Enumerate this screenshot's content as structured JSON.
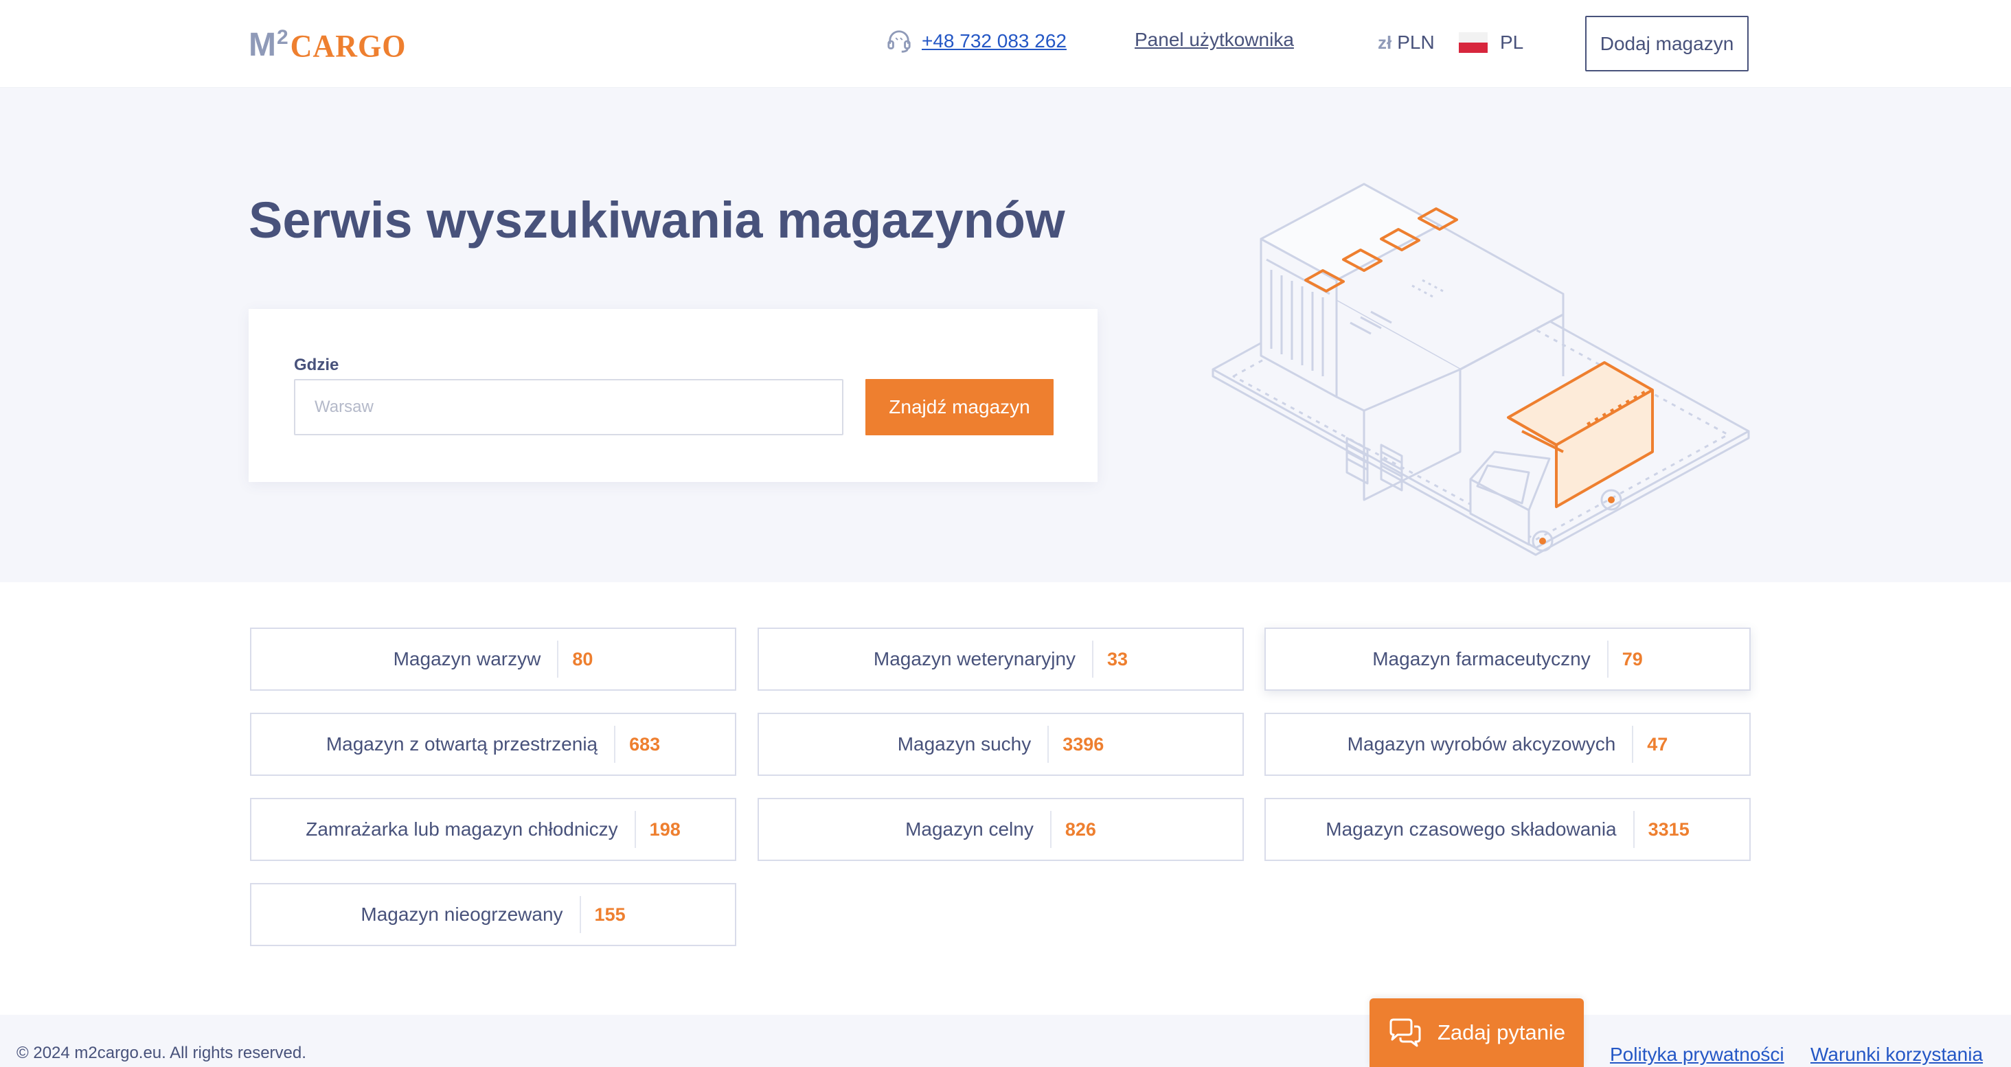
{
  "header": {
    "logo": {
      "m": "M",
      "sup": "2",
      "cargo": "CARGO"
    },
    "phone": "+48 732 083 262",
    "panel_link": "Panel użytkownika",
    "currency": {
      "symbol": "zł",
      "code": "PLN"
    },
    "language": "PL",
    "add_button": "Dodaj magazyn"
  },
  "hero": {
    "title": "Serwis wyszukiwania magazynów",
    "search": {
      "label": "Gdzie",
      "placeholder": "Warsaw",
      "button": "Znajdź magazyn"
    }
  },
  "categories": [
    {
      "name": "Magazyn warzyw",
      "count": "80"
    },
    {
      "name": "Magazyn weterynaryjny",
      "count": "33"
    },
    {
      "name": "Magazyn farmaceutyczny",
      "count": "79"
    },
    {
      "name": "Magazyn z otwartą przestrzenią",
      "count": "683"
    },
    {
      "name": "Magazyn suchy",
      "count": "3396"
    },
    {
      "name": "Magazyn wyrobów akcyzowych",
      "count": "47"
    },
    {
      "name": "Zamrażarka lub magazyn chłodniczy",
      "count": "198"
    },
    {
      "name": "Magazyn celny",
      "count": "826"
    },
    {
      "name": "Magazyn czasowego składowania",
      "count": "3315"
    },
    {
      "name": "Magazyn nieogrzewany",
      "count": "155"
    }
  ],
  "footer": {
    "copyright": "© 2024 m2cargo.eu. All rights reserved.",
    "ask_button": "Zadaj pytanie",
    "privacy": "Polityka prywatności",
    "terms": "Warunki korzystania"
  },
  "colors": {
    "accent": "#ee7f2f",
    "text": "#48527b",
    "link": "#2457c5",
    "hero_bg": "#f5f6fb"
  }
}
